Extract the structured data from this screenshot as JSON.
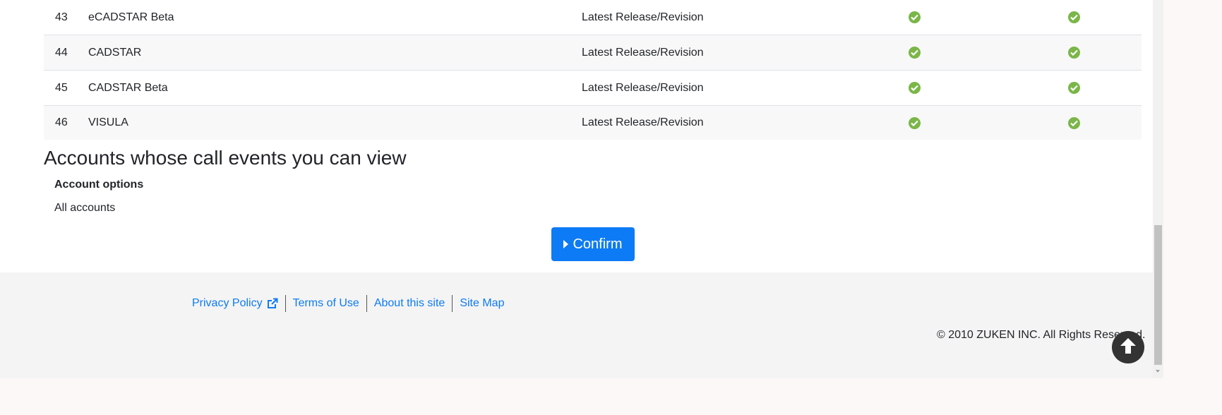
{
  "table": {
    "rows": [
      {
        "num": "43",
        "name": "eCADSTAR Beta",
        "release": "Latest Release/Revision"
      },
      {
        "num": "44",
        "name": "CADSTAR",
        "release": "Latest Release/Revision"
      },
      {
        "num": "45",
        "name": "CADSTAR Beta",
        "release": "Latest Release/Revision"
      },
      {
        "num": "46",
        "name": "VISULA",
        "release": "Latest Release/Revision"
      }
    ],
    "check_icon": "check-circle-icon",
    "check_color": "#7ab648"
  },
  "accounts": {
    "heading": "Accounts whose call events you can view",
    "options_label": "Account options",
    "options_value": "All accounts"
  },
  "confirm": {
    "label": "Confirm",
    "icon": "caret-right-icon",
    "color": "#0d7bf5"
  },
  "footer": {
    "links": [
      "Privacy Policy",
      "Terms of Use",
      "About this site",
      "Site Map"
    ],
    "external_icon": "external-link-icon",
    "copyright": "© 2010 ZUKEN INC. All Rights Reserved.",
    "link_color": "#0d7bf5"
  },
  "scroll_top": {
    "icon": "arrow-up-icon"
  }
}
